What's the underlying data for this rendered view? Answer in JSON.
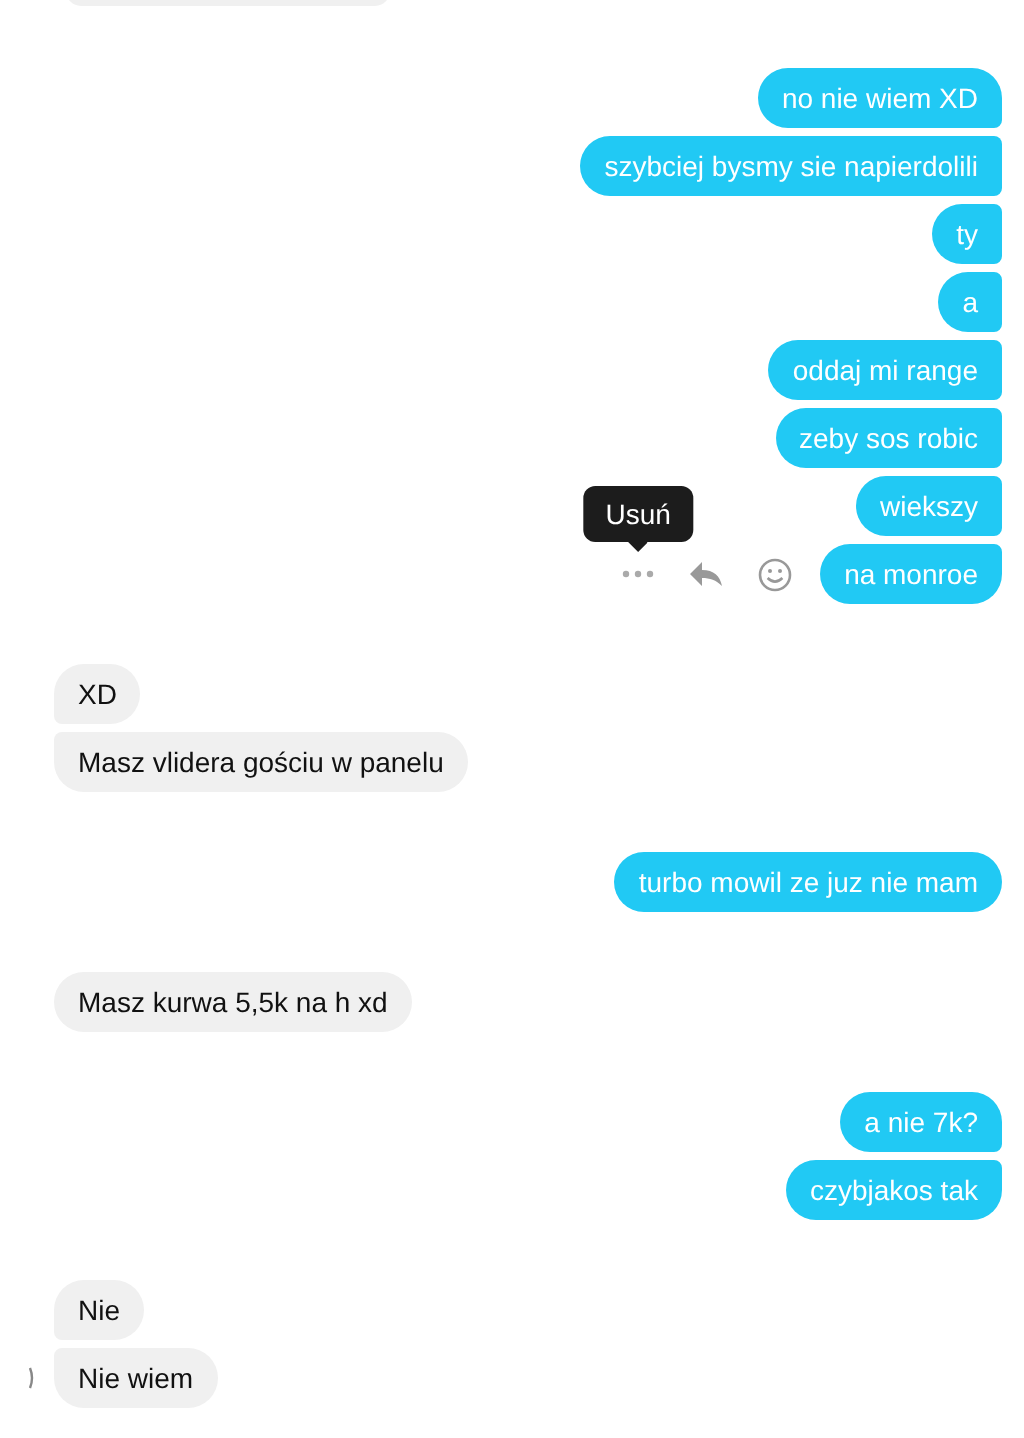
{
  "groups": [
    {
      "outgoing": false,
      "messages": [
        {
          "kind": "clipped"
        }
      ]
    },
    {
      "outgoing": true,
      "messages": [
        {
          "kind": "text",
          "text": "no nie wiem XD"
        },
        {
          "kind": "text",
          "text": "szybciej bysmy sie napierdolili"
        },
        {
          "kind": "text",
          "text": "ty"
        },
        {
          "kind": "text",
          "text": "a"
        },
        {
          "kind": "text",
          "text": "oddaj mi range"
        },
        {
          "kind": "text",
          "text": "zeby sos robic"
        },
        {
          "kind": "text",
          "text": "wiekszy"
        },
        {
          "kind": "text",
          "text": "na monroe",
          "hovered": true,
          "tooltip": "Usuń"
        }
      ]
    },
    {
      "outgoing": false,
      "messages": [
        {
          "kind": "text",
          "text": "XD"
        },
        {
          "kind": "text",
          "text": "Masz vlidera gościu w panelu"
        }
      ]
    },
    {
      "outgoing": true,
      "messages": [
        {
          "kind": "text",
          "text": "turbo mowil ze juz nie mam"
        }
      ]
    },
    {
      "outgoing": false,
      "messages": [
        {
          "kind": "text",
          "text": "Masz kurwa 5,5k na h xd"
        }
      ]
    },
    {
      "outgoing": true,
      "messages": [
        {
          "kind": "text",
          "text": "a nie 7k?"
        },
        {
          "kind": "text",
          "text": "czybjakos tak"
        }
      ]
    },
    {
      "outgoing": false,
      "avatar": true,
      "messages": [
        {
          "kind": "text",
          "text": "Nie"
        },
        {
          "kind": "text",
          "text": "Nie wiem"
        }
      ]
    }
  ]
}
